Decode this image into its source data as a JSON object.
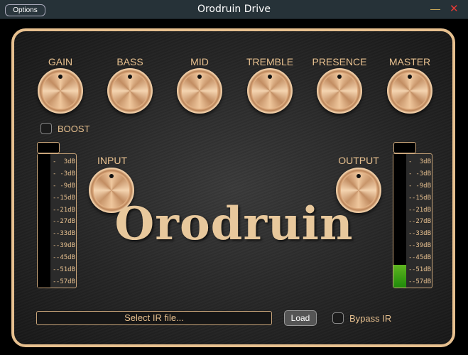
{
  "window": {
    "title": "Orodruin Drive",
    "options_label": "Options",
    "minimize_icon": "minimize-icon",
    "close_icon": "close-icon"
  },
  "knobs": [
    {
      "label": "GAIN"
    },
    {
      "label": "BASS"
    },
    {
      "label": "MID"
    },
    {
      "label": "TREMBLE"
    },
    {
      "label": "PRESENCE"
    },
    {
      "label": "MASTER"
    }
  ],
  "boost": {
    "label": "BOOST",
    "checked": false
  },
  "input": {
    "label": "INPUT"
  },
  "output": {
    "label": "OUTPUT"
  },
  "meter_scale": [
    "3dB",
    "-3dB",
    "-9dB",
    "-15dB",
    "-21dB",
    "-27dB",
    "-33dB",
    "-39dB",
    "-45dB",
    "-51dB",
    "-57dB"
  ],
  "input_meter_level": 0,
  "output_meter_level": 0.17,
  "logo": "Orodruin",
  "ir": {
    "placeholder": "Select IR file...",
    "load_label": "Load",
    "bypass_label": "Bypass IR",
    "bypass_checked": false
  },
  "colors": {
    "accent": "#e7c08f",
    "meter_green": "#4aa418",
    "titlebar": "#263238"
  }
}
